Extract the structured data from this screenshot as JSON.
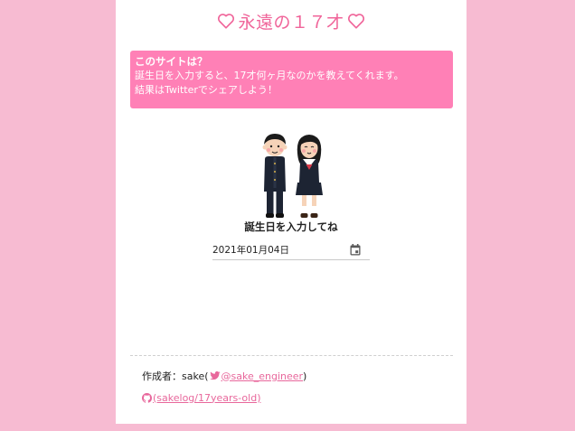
{
  "header": {
    "title": "永遠の１７才",
    "heart_icon": "heart-outline-icon"
  },
  "info": {
    "heading": "このサイトは？",
    "line1": "誕生日を入力すると、17才何ヶ月なのかを教えてくれます。",
    "line2": "結果はTwitterでシェアしよう！"
  },
  "illustration": {
    "name": "student-couple-illustration"
  },
  "form": {
    "prompt": "誕生日を入力してね",
    "date_value": "2021年01月04日",
    "calendar_icon": "calendar-icon"
  },
  "footer": {
    "author_prefix": "作成者：sake(",
    "twitter_handle": "@sake_engineer",
    "author_suffix": ")",
    "repo_link": "(sakelog/17years-old)",
    "twitter_icon": "twitter-icon",
    "github_icon": "github-icon"
  },
  "colors": {
    "background": "#f7bbd2",
    "accent": "#f0659a",
    "info_box": "#ff80b6",
    "link": "#e8689c"
  }
}
